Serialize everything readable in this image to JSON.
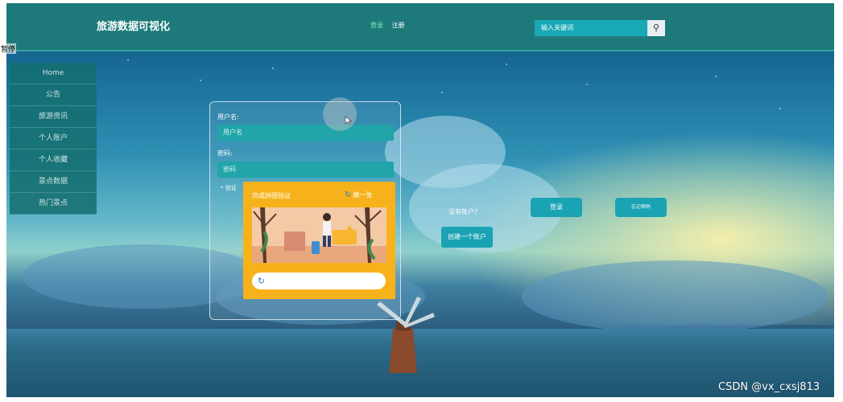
{
  "header": {
    "site_title": "旅游数据可视化",
    "login_link": "登录",
    "register_link": "注册",
    "search_placeholder": "输入关键词",
    "search_icon": "search-icon"
  },
  "corner_label": "暂停",
  "sidebar": {
    "items": [
      {
        "label": "Home"
      },
      {
        "label": "公告"
      },
      {
        "label": "旅游资讯"
      },
      {
        "label": "个人账户"
      },
      {
        "label": "个人收藏"
      },
      {
        "label": "景点数据"
      },
      {
        "label": "热门景点"
      }
    ]
  },
  "login_form": {
    "username_label": "用户名:",
    "username_placeholder": "用户名",
    "password_label": "密码:",
    "password_placeholder": "密码",
    "verify_label": "* 验证"
  },
  "captcha": {
    "title": "完成拼图验证",
    "refresh_label": "换一张"
  },
  "actions": {
    "no_account_text": "没有账户?",
    "create_account_button": "创建一个账户",
    "login_button": "登录",
    "forgot_password_button": "忘记密码"
  },
  "watermark": "CSDN @vx_cxsj813",
  "colors": {
    "header": "#1e7a7a",
    "sidebar": "#146e6e",
    "accent": "#1aa3b3",
    "captcha": "#f7b21b"
  }
}
